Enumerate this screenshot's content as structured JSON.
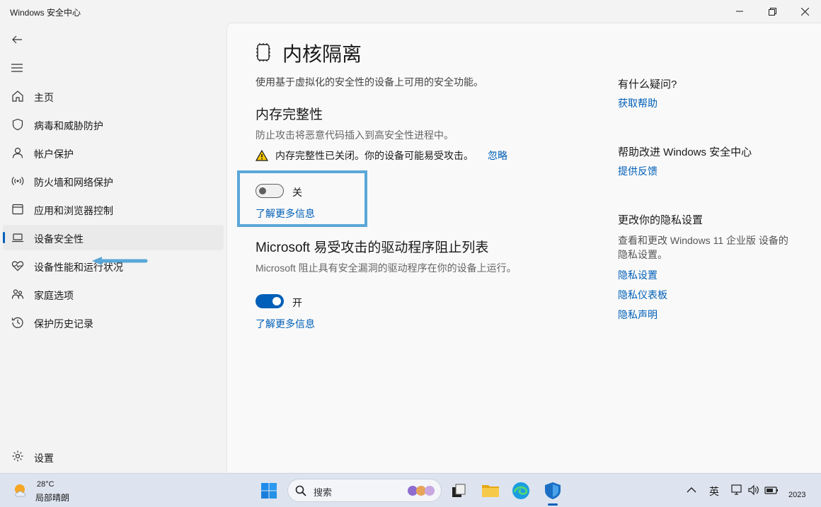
{
  "window": {
    "title": "Windows 安全中心"
  },
  "nav": {
    "items": [
      {
        "label": "主页",
        "icon": "home-icon"
      },
      {
        "label": "病毒和威胁防护",
        "icon": "shield-icon"
      },
      {
        "label": "帐户保护",
        "icon": "person-icon"
      },
      {
        "label": "防火墙和网络保护",
        "icon": "wifi-signal-icon"
      },
      {
        "label": "应用和浏览器控制",
        "icon": "app-window-icon"
      },
      {
        "label": "设备安全性",
        "icon": "laptop-icon",
        "active": true
      },
      {
        "label": "设备性能和运行状况",
        "icon": "heart-pulse-icon"
      },
      {
        "label": "家庭选项",
        "icon": "family-icon"
      },
      {
        "label": "保护历史记录",
        "icon": "history-icon"
      }
    ],
    "settings_label": "设置"
  },
  "page": {
    "title": "内核隔离",
    "description": "使用基于虚拟化的安全性的设备上可用的安全功能。",
    "memory_integrity": {
      "title": "内存完整性",
      "description": "防止攻击将恶意代码插入到高安全性进程中。",
      "warning": "内存完整性已关闭。你的设备可能易受攻击。",
      "dismiss": "忽略",
      "toggle_state": "关",
      "toggle_on": false,
      "learn_more": "了解更多信息"
    },
    "driver_blocklist": {
      "title": "Microsoft 易受攻击的驱动程序阻止列表",
      "description": "Microsoft 阻止具有安全漏洞的驱动程序在你的设备上运行。",
      "toggle_state": "开",
      "toggle_on": true,
      "learn_more": "了解更多信息"
    }
  },
  "aside": {
    "questions": {
      "heading": "有什么疑问?",
      "link": "获取帮助"
    },
    "improve": {
      "heading": "帮助改进 Windows 安全中心",
      "link": "提供反馈"
    },
    "privacy": {
      "heading": "更改你的隐私设置",
      "text": "查看和更改 Windows 11 企业版 设备的隐私设置。",
      "links": [
        "隐私设置",
        "隐私仪表板",
        "隐私声明"
      ]
    }
  },
  "taskbar": {
    "weather": {
      "temp": "28°C",
      "condition": "局部晴朗"
    },
    "search_label": "搜索",
    "ime": "英",
    "clock": "2023"
  },
  "colors": {
    "accent": "#005fb8",
    "highlight_box": "#5aa7d8",
    "warning": "#f7c600"
  }
}
